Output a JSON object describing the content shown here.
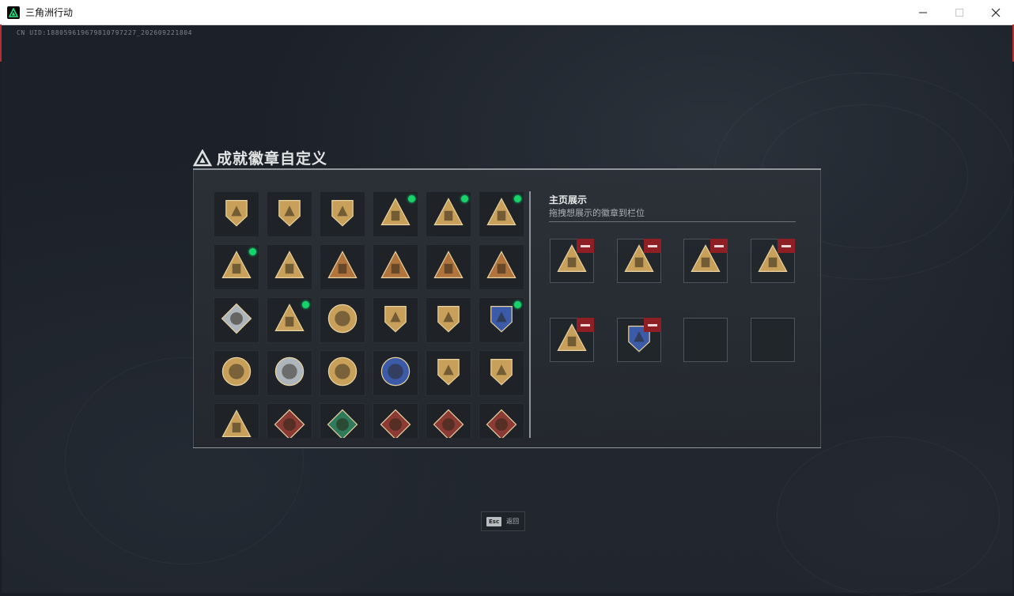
{
  "window": {
    "title": "三角洲行动",
    "icon": "delta-force-logo-icon",
    "controls": [
      "minimize-icon",
      "maximize-icon",
      "close-icon"
    ]
  },
  "uid_text": "CN UID:18805961967981079​7227_202609221804",
  "panel": {
    "title": "成就徽章自定义",
    "title_icon": "triangle-logo-icon"
  },
  "badges": [
    {
      "icon": "triangle-mountain-badge-icon",
      "new": false,
      "style": "gold"
    },
    {
      "icon": "helicopter-badge-icon",
      "new": false,
      "style": "gold"
    },
    {
      "icon": "jet-shield-badge-icon",
      "new": false,
      "style": "gold"
    },
    {
      "icon": "gas-mask-badge-icon",
      "new": true,
      "style": "gold"
    },
    {
      "icon": "sb-badge-icon",
      "new": true,
      "style": "gold"
    },
    {
      "icon": "turret-badge-icon",
      "new": true,
      "style": "gold"
    },
    {
      "icon": "eagle-crest-badge-icon",
      "new": true,
      "style": "gold"
    },
    {
      "icon": "boat-badge-icon",
      "new": false,
      "style": "gold"
    },
    {
      "icon": "rank-1-badge-icon",
      "new": false,
      "style": "bronze"
    },
    {
      "icon": "rank-2-badge-icon",
      "new": false,
      "style": "bronze"
    },
    {
      "icon": "lantern-badge-icon",
      "new": false,
      "style": "bronze"
    },
    {
      "icon": "soldier-badge-icon",
      "new": false,
      "style": "bronze"
    },
    {
      "icon": "crystal-badge-icon",
      "new": false,
      "style": "silver"
    },
    {
      "icon": "armor-badge-icon",
      "new": true,
      "style": "gold"
    },
    {
      "icon": "star-medal-badge-icon",
      "new": false,
      "style": "gold"
    },
    {
      "icon": "shield-arrow-badge-icon",
      "new": false,
      "style": "gold"
    },
    {
      "icon": "stars-emblem-badge-icon",
      "new": false,
      "style": "gold"
    },
    {
      "icon": "wolf-shield-badge-icon",
      "new": true,
      "style": "blue"
    },
    {
      "icon": "skull-target-badge-icon",
      "new": false,
      "style": "gold"
    },
    {
      "icon": "wolf-silver-badge-icon",
      "new": false,
      "style": "silver"
    },
    {
      "icon": "compass-star-badge-icon",
      "new": false,
      "style": "gold"
    },
    {
      "icon": "rifle-circle-badge-icon",
      "new": false,
      "style": "blue"
    },
    {
      "icon": "rifle-shield-badge-icon",
      "new": false,
      "style": "gold"
    },
    {
      "icon": "gun-shield-badge-icon",
      "new": false,
      "style": "gold"
    },
    {
      "icon": "crossed-rifles-badge-icon",
      "new": false,
      "style": "gold"
    },
    {
      "icon": "dragon-red-badge-icon",
      "new": false,
      "style": "red"
    },
    {
      "icon": "hex-soldier-badge-icon",
      "new": false,
      "style": "green"
    },
    {
      "icon": "dragon-fire-badge-icon",
      "new": false,
      "style": "red"
    },
    {
      "icon": "dragon-head-badge-icon",
      "new": false,
      "style": "red"
    },
    {
      "icon": "runner-badge-icon",
      "new": false,
      "style": "red"
    }
  ],
  "showcase": {
    "title": "主页展示",
    "subtitle": "拖拽想展示的徽章到栏位",
    "slots": [
      {
        "icon": "gas-mask-badge-icon",
        "filled": true
      },
      {
        "icon": "sb-badge-icon",
        "filled": true
      },
      {
        "icon": "turret-badge-icon",
        "filled": true
      },
      {
        "icon": "eagle-crest-badge-icon",
        "filled": true
      },
      {
        "icon": "armor-badge-icon",
        "filled": true
      },
      {
        "icon": "wolf-shield-badge-icon",
        "filled": true
      },
      {
        "icon": "",
        "filled": false
      },
      {
        "icon": "",
        "filled": false
      }
    ],
    "remove_icon": "minus-icon"
  },
  "esc": {
    "key": "Esc",
    "label": "返回"
  },
  "colors": {
    "new_dot": "#18d36a",
    "remove_bg": "#8e1f24",
    "gold": "#c8a05a",
    "bronze": "#b2743d",
    "silver": "#aeb6bd",
    "blue": "#3b5aa8",
    "red": "#8b3b34",
    "green": "#2e7a5a"
  }
}
